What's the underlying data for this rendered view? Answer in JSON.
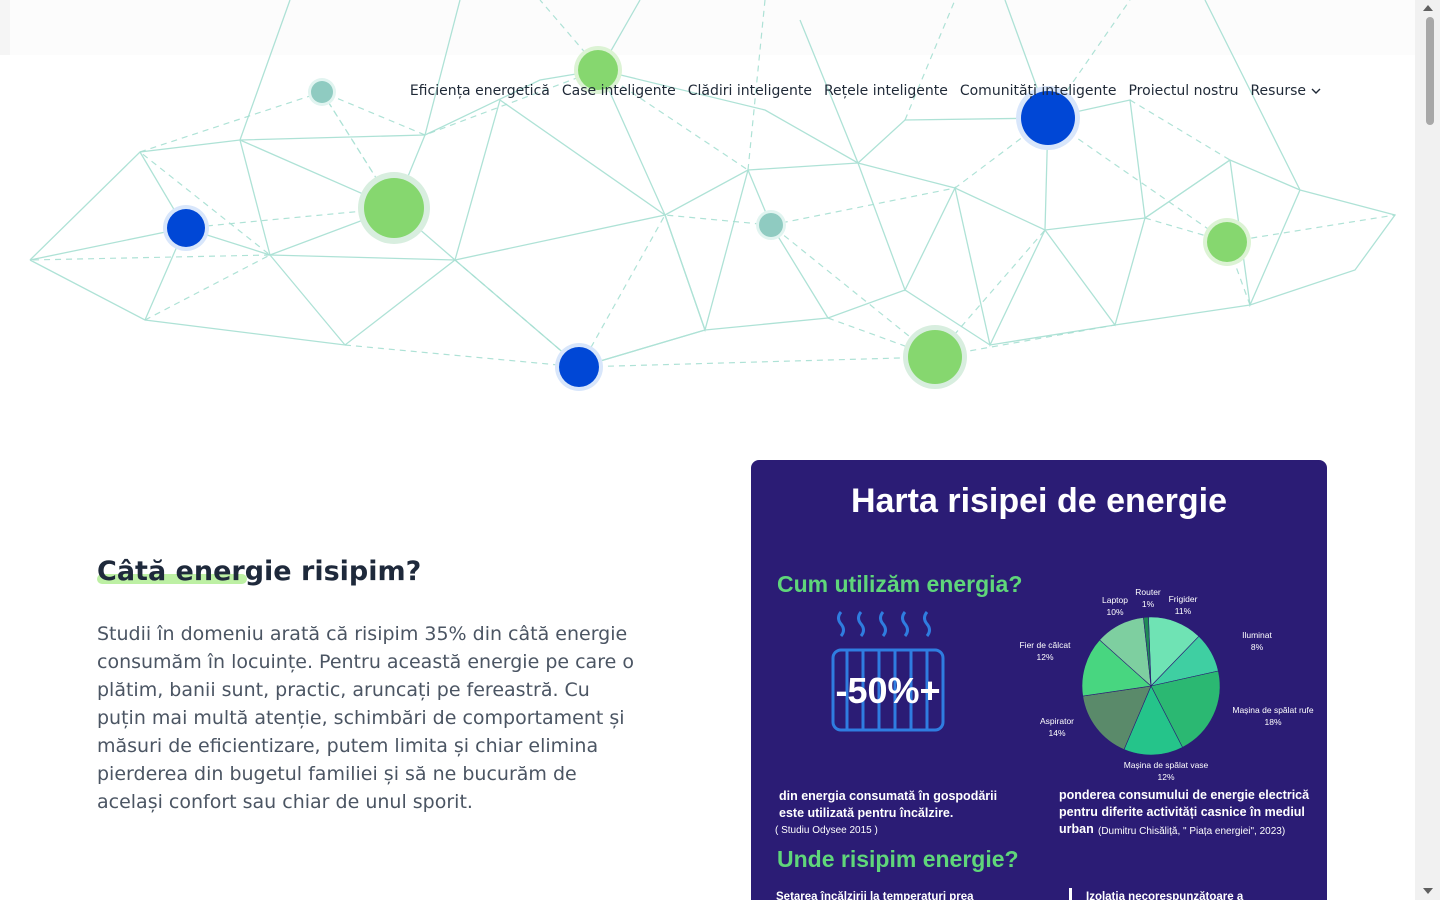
{
  "nav": {
    "items": [
      "Eficiența energetică",
      "Case inteligente",
      "Clădiri inteligente",
      "Rețele inteligente",
      "Comunități inteligente",
      "Proiectul nostru"
    ],
    "resources_label": "Resurse",
    "resources_icon": "chevron-down-icon"
  },
  "hero": {
    "decoration": "network-graph",
    "colors": {
      "line": "#9fdccf",
      "green": "#86d76f",
      "blue": "#0047d6",
      "teal": "#8fcbc1"
    }
  },
  "section": {
    "heading": "Câtă energie risipim?",
    "body": "Studii în domeniu arată că risipim 35% din câtă energie consumăm în locuințe. Pentru această energie pe care o plătim, banii sunt, practic, aruncați pe fereastră. Cu puțin mai multă atenție, schimbări de comportament și măsuri de eficientizare, putem limita și chiar elimina pierderea din bugetul familiei și să ne bucurăm de același confort sau chiar de unul sporit."
  },
  "infographic": {
    "title": "Harta risipei de energie",
    "section1_title": "Cum utilizăm energia?",
    "big_stat": "-50%+",
    "stat_caption_line1": "din energia consumată în gospodării",
    "stat_caption_line2": "este utilizată pentru încălzire.",
    "stat_source": "( Studiu Odysee 2015 )",
    "pie_caption_line1": "ponderea consumului de energie electrică",
    "pie_caption_line2": "pentru diferite activități casnice în mediul",
    "pie_caption_line3": "urban",
    "pie_source": "(Dumitru Chisăliță, \" Piața energiei\", 2023)",
    "section2_title": "Unde risipim energie?",
    "bottom_left_text": "Setarea încălzirii la temperaturi prea",
    "bottom_right_text": "Izolația necorespunzătoare a",
    "colors": {
      "background": "#2b1c75",
      "accent": "#5fd67a",
      "text": "#ffffff"
    }
  },
  "chart_data": {
    "type": "pie",
    "title": "",
    "categories": [
      "Frigider",
      "Iluminat",
      "Mașina de spălat rufe",
      "Mașina de spălat vase",
      "Aspirator",
      "Fier de călcat",
      "Laptop",
      "Router"
    ],
    "values": [
      11,
      8,
      18,
      12,
      14,
      12,
      10,
      1
    ],
    "labels": [
      {
        "name": "Frigider",
        "pct": "11%"
      },
      {
        "name": "Iluminat",
        "pct": "8%"
      },
      {
        "name": "Mașina de spălat rufe",
        "pct": "18%"
      },
      {
        "name": "Mașina de spălat vase",
        "pct": "12%"
      },
      {
        "name": "Aspirator",
        "pct": "14%"
      },
      {
        "name": "Fier de călcat",
        "pct": "12%"
      },
      {
        "name": "Laptop",
        "pct": "10%"
      },
      {
        "name": "Router",
        "pct": "1%"
      }
    ],
    "colors": [
      "#6fe3b4",
      "#3fcfa2",
      "#2bb872",
      "#25c48a",
      "#5a8a6a",
      "#48d680",
      "#7ecfa0",
      "#1f8a55"
    ]
  }
}
